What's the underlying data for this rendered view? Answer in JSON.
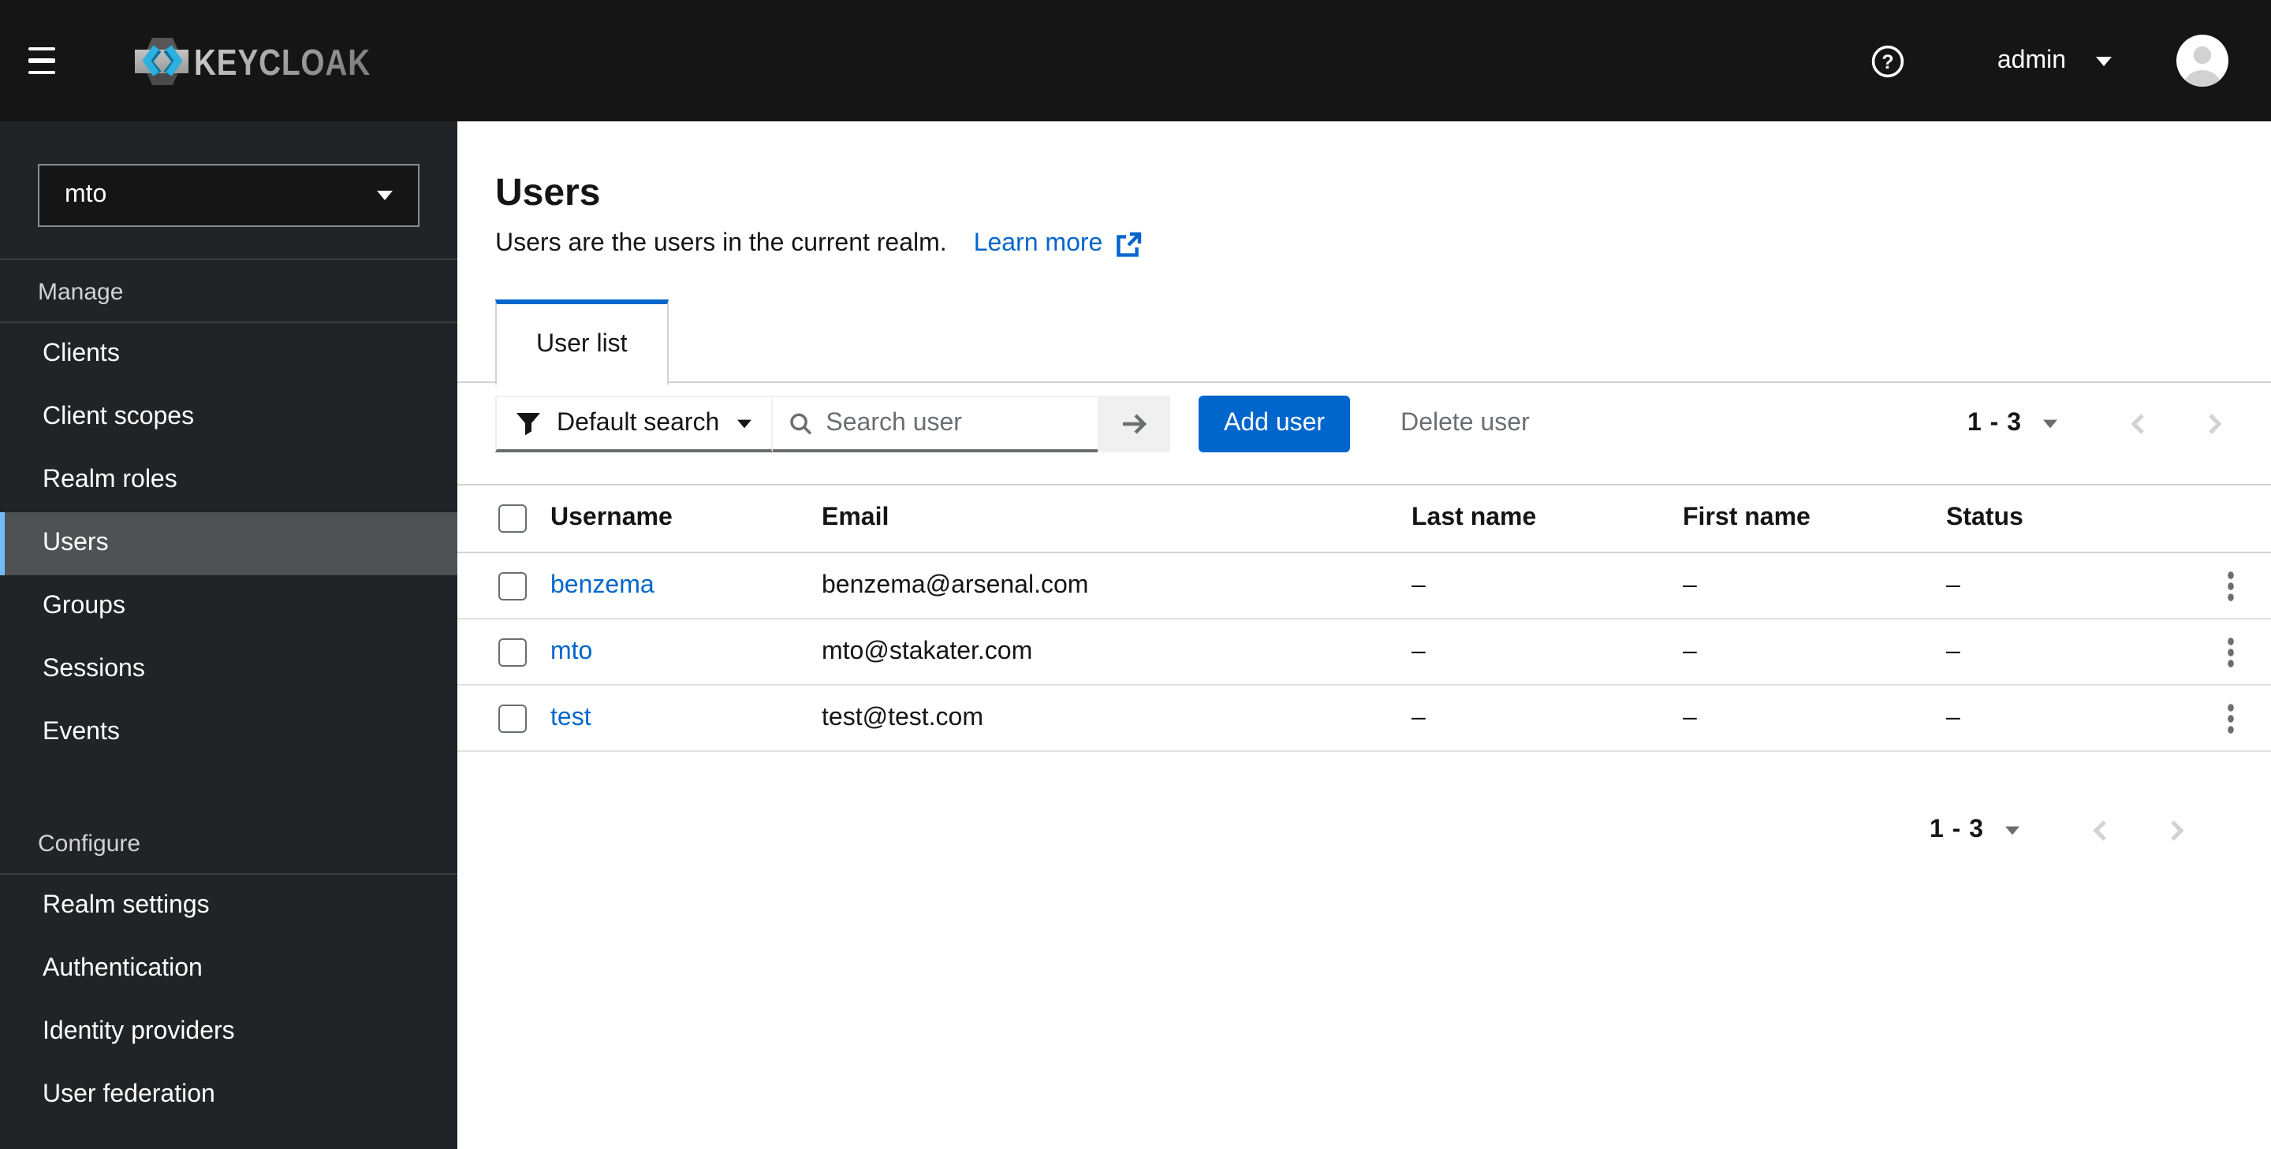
{
  "colors": {
    "primary": "#0066cc",
    "masthead_bg": "#151515",
    "sidebar_bg": "#212427",
    "nav_active_bg": "#4f5255",
    "nav_active_border": "#73bcf7",
    "text": "#151515",
    "muted_text": "#6a6e73",
    "border": "#d2d2d2",
    "row_border": "#e0e0e0",
    "disabled_icon": "#d2d2d2",
    "logo_blue": "#2db0e0"
  },
  "masthead": {
    "brand": "KEYCLOAK",
    "help_label": "?",
    "username": "admin"
  },
  "sidebar": {
    "realm": "mto",
    "sections": [
      {
        "label": "Manage",
        "items": [
          "Clients",
          "Client scopes",
          "Realm roles",
          "Users",
          "Groups",
          "Sessions",
          "Events"
        ],
        "active_item": "Users"
      },
      {
        "label": "Configure",
        "items": [
          "Realm settings",
          "Authentication",
          "Identity providers",
          "User federation"
        ]
      }
    ]
  },
  "page": {
    "title": "Users",
    "description": "Users are the users in the current realm.",
    "learn_more_label": "Learn more",
    "tabs": [
      {
        "label": "User list",
        "active": true
      }
    ]
  },
  "toolbar": {
    "filter_label": "Default search",
    "search_placeholder": "Search user",
    "add_user_label": "Add user",
    "delete_user_label": "Delete user"
  },
  "table": {
    "columns": [
      "Username",
      "Email",
      "Last name",
      "First name",
      "Status"
    ],
    "rows": [
      {
        "username": "benzema",
        "email": "benzema@arsenal.com",
        "last_name": "–",
        "first_name": "–",
        "status": "–",
        "checked": false
      },
      {
        "username": "mto",
        "email": "mto@stakater.com",
        "last_name": "–",
        "first_name": "–",
        "status": "–",
        "checked": false
      },
      {
        "username": "test",
        "email": "test@test.com",
        "last_name": "–",
        "first_name": "–",
        "status": "–",
        "checked": false
      }
    ]
  },
  "pagination": {
    "top_range": "1 - 3",
    "bottom_range": "1 - 3"
  },
  "icons": {
    "menu": "hamburger",
    "help": "question-circle",
    "user_caret": "triangle-down",
    "realm_caret": "triangle-down",
    "filter": "funnel",
    "search": "magnifier",
    "search_submit": "arrow-right",
    "external_link": "external-link-box-arrow",
    "pagination_caret": "triangle-down",
    "chevron_left": "angle-left",
    "chevron_right": "angle-right",
    "kebab": "three-vertical-dots",
    "avatar": "person-silhouette"
  }
}
